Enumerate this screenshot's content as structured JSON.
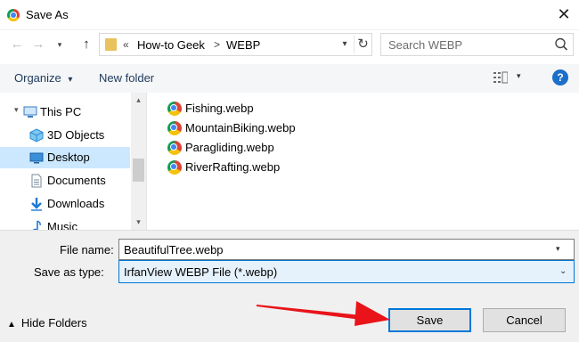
{
  "window": {
    "title": "Save As",
    "close_icon": "close-icon",
    "logo_icon": "chrome-logo-icon"
  },
  "nav": {
    "back_icon": "arrow-left-icon",
    "forward_icon": "arrow-right-icon",
    "recent_icon": "chevron-down-icon",
    "up_icon": "arrow-up-icon"
  },
  "address": {
    "prefix": "«",
    "segments": [
      "How-to Geek",
      "WEBP"
    ],
    "separator": ">",
    "refresh_icon": "refresh-icon"
  },
  "search": {
    "placeholder": "Search WEBP",
    "icon": "search-icon"
  },
  "toolbar": {
    "organize_label": "Organize",
    "organize_caret": "▾",
    "new_folder_label": "New folder",
    "view_icon": "view-options-icon",
    "view_caret": "▾",
    "help_label": "?"
  },
  "sidebar": {
    "items": [
      {
        "label": "This PC",
        "icon": "this-pc-icon",
        "selected": false
      },
      {
        "label": "3D Objects",
        "icon": "3d-objects-icon",
        "selected": false
      },
      {
        "label": "Desktop",
        "icon": "desktop-icon",
        "selected": true
      },
      {
        "label": "Documents",
        "icon": "documents-icon",
        "selected": false
      },
      {
        "label": "Downloads",
        "icon": "downloads-icon",
        "selected": false
      },
      {
        "label": "Music",
        "icon": "music-icon",
        "selected": false
      }
    ]
  },
  "files": [
    {
      "name": "Fishing.webp",
      "icon": "chrome-file-icon"
    },
    {
      "name": "MountainBiking.webp",
      "icon": "chrome-file-icon"
    },
    {
      "name": "Paragliding.webp",
      "icon": "chrome-file-icon"
    },
    {
      "name": "RiverRafting.webp",
      "icon": "chrome-file-icon"
    }
  ],
  "form": {
    "file_name_label": "File name:",
    "file_name_value": "BeautifulTree.webp",
    "save_type_label": "Save as type:",
    "save_type_value": "IrfanView WEBP File (*.webp)"
  },
  "footer": {
    "hide_folders_label": "Hide Folders",
    "hide_folders_icon": "chevron-up-icon",
    "save_label": "Save",
    "cancel_label": "Cancel"
  },
  "colors": {
    "accent": "#0078d7",
    "selection": "#cce8ff",
    "annotation_arrow": "#e8141a"
  }
}
